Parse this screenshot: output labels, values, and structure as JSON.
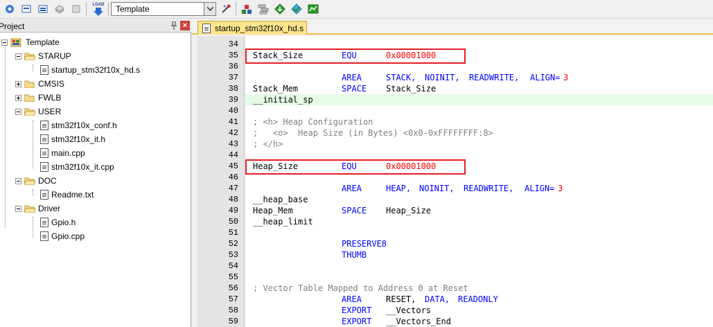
{
  "toolbar": {
    "icons": [
      "translate-icon",
      "build-icon",
      "rebuild-icon",
      "batch-build-icon",
      "stop-build-icon",
      "download-icon",
      "options-icon",
      "manage-components-icon",
      "file-extensions-icon",
      "pack-installer-icon",
      "select-packs-icon",
      "manage-env-icon"
    ],
    "load_label": "LOAD",
    "target_value": "Template"
  },
  "project_panel": {
    "title": "Project",
    "close_glyph": "×",
    "tree": [
      {
        "label": "Template",
        "kind": "root"
      },
      {
        "label": "STARUP",
        "kind": "folder",
        "expanded": true
      },
      {
        "label": "startup_stm32f10x_hd.s",
        "kind": "file"
      },
      {
        "label": "CMSIS",
        "kind": "folder",
        "expanded": false
      },
      {
        "label": "FWLB",
        "kind": "folder",
        "expanded": false
      },
      {
        "label": "USER",
        "kind": "folder",
        "expanded": true
      },
      {
        "label": "stm32f10x_conf.h",
        "kind": "file"
      },
      {
        "label": "stm32f10x_it.h",
        "kind": "file"
      },
      {
        "label": "main.cpp",
        "kind": "file"
      },
      {
        "label": "stm32f10x_it.cpp",
        "kind": "file"
      },
      {
        "label": "DOC",
        "kind": "folder",
        "expanded": true
      },
      {
        "label": "Readme.txt",
        "kind": "file"
      },
      {
        "label": "Driver",
        "kind": "folder",
        "expanded": true
      },
      {
        "label": "Gpio.h",
        "kind": "file"
      },
      {
        "label": "Gpio.cpp",
        "kind": "file"
      }
    ]
  },
  "editor": {
    "tab_label": "startup_stm32f10x_hd.s",
    "lines": [
      {
        "num": "34",
        "segs": []
      },
      {
        "num": "35",
        "segs": [
          {
            "t": "Stack_Size",
            "c": "pl",
            "col": 0
          },
          {
            "t": "EQU",
            "c": "kw",
            "col": 16
          },
          {
            "t": "0x00001000",
            "c": "num",
            "col": 24
          }
        ]
      },
      {
        "num": "36",
        "segs": []
      },
      {
        "num": "37",
        "segs": [
          {
            "t": "AREA",
            "c": "kw",
            "col": 16
          },
          {
            "t": "STACK,",
            "c": "kw",
            "col": 24
          },
          {
            "t": "NOINIT,",
            "c": "kw",
            "col": 31
          },
          {
            "t": "READWRITE,",
            "c": "kw",
            "col": 39
          },
          {
            "t": "ALIGN=",
            "c": "kw",
            "col": 50
          },
          {
            "t": "3",
            "c": "num",
            "col": 56
          }
        ]
      },
      {
        "num": "38",
        "segs": [
          {
            "t": "Stack_Mem",
            "c": "pl",
            "col": 0
          },
          {
            "t": "SPACE",
            "c": "kw",
            "col": 16
          },
          {
            "t": "Stack_Size",
            "c": "pl",
            "col": 24
          }
        ]
      },
      {
        "num": "39",
        "segs": [
          {
            "t": "__initial_sp",
            "c": "pl",
            "col": 0
          }
        ],
        "current": true
      },
      {
        "num": "40",
        "segs": []
      },
      {
        "num": "41",
        "segs": [
          {
            "t": "; <h> Heap Configuration",
            "c": "cm",
            "col": 0
          }
        ]
      },
      {
        "num": "42",
        "segs": [
          {
            "t": ";   <o>  Heap Size (in Bytes) <0x0-0xFFFFFFFF:8>",
            "c": "cm",
            "col": 0
          }
        ]
      },
      {
        "num": "43",
        "segs": [
          {
            "t": "; </h>",
            "c": "cm",
            "col": 0
          }
        ]
      },
      {
        "num": "44",
        "segs": []
      },
      {
        "num": "45",
        "segs": [
          {
            "t": "Heap_Size",
            "c": "pl",
            "col": 0
          },
          {
            "t": "EQU",
            "c": "kw",
            "col": 16
          },
          {
            "t": "0x00001000",
            "c": "num",
            "col": 24
          }
        ]
      },
      {
        "num": "46",
        "segs": []
      },
      {
        "num": "47",
        "segs": [
          {
            "t": "AREA",
            "c": "kw",
            "col": 16
          },
          {
            "t": "HEAP,",
            "c": "kw",
            "col": 24
          },
          {
            "t": "NOINIT,",
            "c": "kw",
            "col": 30
          },
          {
            "t": "READWRITE,",
            "c": "kw",
            "col": 38
          },
          {
            "t": "ALIGN=",
            "c": "kw",
            "col": 49
          },
          {
            "t": "3",
            "c": "num",
            "col": 55
          }
        ]
      },
      {
        "num": "48",
        "segs": [
          {
            "t": "__heap_base",
            "c": "pl",
            "col": 0
          }
        ]
      },
      {
        "num": "49",
        "segs": [
          {
            "t": "Heap_Mem",
            "c": "pl",
            "col": 0
          },
          {
            "t": "SPACE",
            "c": "kw",
            "col": 16
          },
          {
            "t": "Heap_Size",
            "c": "pl",
            "col": 24
          }
        ]
      },
      {
        "num": "50",
        "segs": [
          {
            "t": "__heap_limit",
            "c": "pl",
            "col": 0
          }
        ]
      },
      {
        "num": "51",
        "segs": []
      },
      {
        "num": "52",
        "segs": [
          {
            "t": "PRESERVE8",
            "c": "kw",
            "col": 16
          }
        ]
      },
      {
        "num": "53",
        "segs": [
          {
            "t": "THUMB",
            "c": "kw",
            "col": 16
          }
        ]
      },
      {
        "num": "54",
        "segs": []
      },
      {
        "num": "55",
        "segs": []
      },
      {
        "num": "56",
        "segs": [
          {
            "t": "; Vector Table Mapped to Address 0 at Reset",
            "c": "cm",
            "col": 0
          }
        ]
      },
      {
        "num": "57",
        "segs": [
          {
            "t": "AREA",
            "c": "kw",
            "col": 16
          },
          {
            "t": "RESET,",
            "c": "pl",
            "col": 24
          },
          {
            "t": "DATA,",
            "c": "kw",
            "col": 31
          },
          {
            "t": "READONLY",
            "c": "kw",
            "col": 37
          }
        ]
      },
      {
        "num": "58",
        "segs": [
          {
            "t": "EXPORT",
            "c": "kw",
            "col": 16
          },
          {
            "t": "__Vectors",
            "c": "pl",
            "col": 24
          }
        ]
      },
      {
        "num": "59",
        "segs": [
          {
            "t": "EXPORT",
            "c": "kw",
            "col": 16
          },
          {
            "t": "__Vectors_End",
            "c": "pl",
            "col": 24
          }
        ]
      }
    ],
    "highlighted_lines": [
      "35",
      "45"
    ]
  },
  "colors": {
    "keyword": "#0000ff",
    "number": "#ff0000",
    "comment": "#808080",
    "highlight_box": "#e31e24",
    "current_line": "#e6fbe6",
    "tab_active": "#fde58c"
  }
}
